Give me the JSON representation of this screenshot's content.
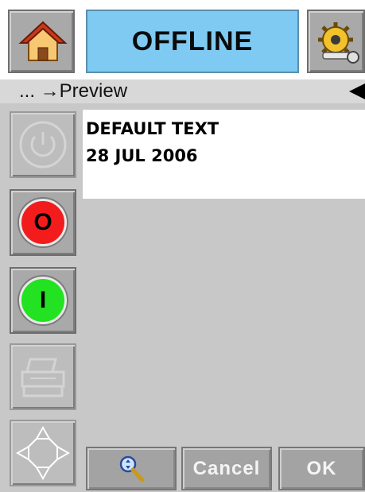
{
  "header": {
    "status": "OFFLINE",
    "home_icon": "home-icon",
    "settings_icon": "settings-gear-icon"
  },
  "breadcrumb": {
    "text": "... →Preview",
    "back_icon": "back-arrow-icon"
  },
  "preview": {
    "lines": [
      "DEFAULT TEXT",
      "28 JUL 2006"
    ]
  },
  "left_buttons": {
    "power_icon": "power-icon",
    "stop_label": "O",
    "start_label": "I",
    "print_icon": "printer-icon",
    "nav_icon": "navigation-arrows-icon"
  },
  "footer": {
    "zoom_icon": "zoom-icon",
    "cancel_label": "Cancel",
    "ok_label": "OK"
  },
  "colors": {
    "status_bg": "#7fcaf2",
    "stop": "#f21c1c",
    "start": "#22e222"
  }
}
